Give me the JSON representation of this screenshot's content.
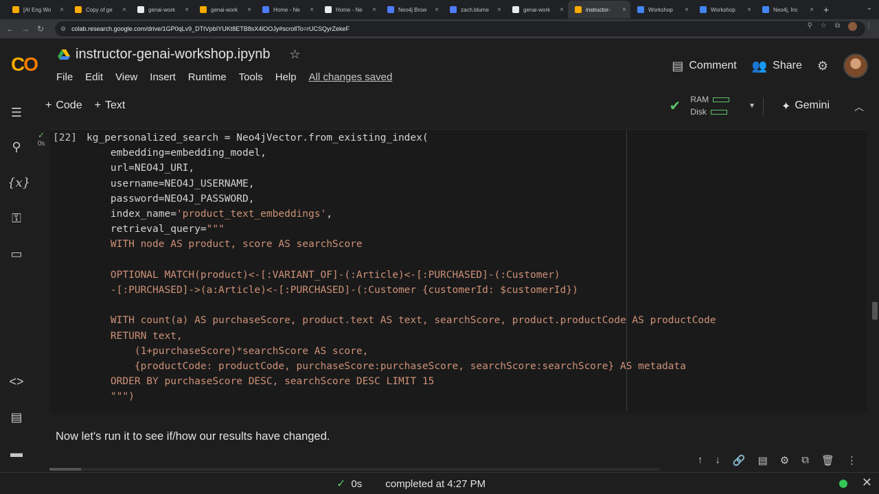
{
  "browser": {
    "tabs": [
      {
        "title": "[AI Eng Wo",
        "favicon_color": "#f9ab00",
        "active": false
      },
      {
        "title": "Copy of ge",
        "favicon_color": "#f9ab00",
        "active": false
      },
      {
        "title": "genai-work",
        "favicon_color": "#e8eaed",
        "active": false
      },
      {
        "title": "genai-work",
        "favicon_color": "#f9ab00",
        "active": false
      },
      {
        "title": "Home - Ne",
        "favicon_color": "#4d7cfe",
        "active": false
      },
      {
        "title": "Home - Ne",
        "favicon_color": "#e8eaed",
        "active": false
      },
      {
        "title": "Neo4j Brow",
        "favicon_color": "#4d7cfe",
        "active": false
      },
      {
        "title": "zach.blume",
        "favicon_color": "#4d7cfe",
        "active": false
      },
      {
        "title": "genai-work",
        "favicon_color": "#e8eaed",
        "active": false
      },
      {
        "title": "instructor-",
        "favicon_color": "#f9ab00",
        "active": true
      },
      {
        "title": "Workshop",
        "favicon_color": "#4285f4",
        "active": false
      },
      {
        "title": "Workshop",
        "favicon_color": "#4285f4",
        "active": false
      },
      {
        "title": "Neo4j, Inc",
        "favicon_color": "#4285f4",
        "active": false
      }
    ],
    "url": "colab.research.google.com/drive/1GP0qLv9_DTtVpbIYUKt8ETB8sX4lOOJy#scrollTo=rUCSQyrZekeF"
  },
  "header": {
    "title": "instructor-genai-workshop.ipynb",
    "menu": [
      "File",
      "Edit",
      "View",
      "Insert",
      "Runtime",
      "Tools",
      "Help"
    ],
    "saved_status": "All changes saved",
    "comment_label": "Comment",
    "share_label": "Share"
  },
  "toolbar": {
    "add_code_label": "Code",
    "add_text_label": "Text",
    "ram_label": "RAM",
    "disk_label": "Disk",
    "gemini_label": "Gemini"
  },
  "cell": {
    "exec_count": "[22]",
    "exec_time": "0s",
    "lines": [
      "kg_personalized_search = Neo4jVector.from_existing_index(",
      "    embedding=embedding_model,",
      "    url=NEO4J_URI,",
      "    username=NEO4J_USERNAME,",
      "    password=NEO4J_PASSWORD,",
      "    index_name='product_text_embeddings',",
      "    retrieval_query=\"\"\"",
      "    WITH node AS product, score AS searchScore",
      "",
      "    OPTIONAL MATCH(product)<-[:VARIANT_OF]-(:Article)<-[:PURCHASED]-(:Customer)",
      "    -[:PURCHASED]->(a:Article)<-[:PURCHASED]-(:Customer {customerId: $customerId})",
      "",
      "    WITH count(a) AS purchaseScore, product.text AS text, searchScore, product.productCode AS productCode",
      "    RETURN text,",
      "        (1+purchaseScore)*searchScore AS score,",
      "        {productCode: productCode, purchaseScore:purchaseScore, searchScore:searchScore} AS metadata",
      "    ORDER BY purchaseScore DESC, searchScore DESC LIMIT 15",
      "    \"\"\")"
    ]
  },
  "text_cell": {
    "text": "Now let's run it to see if/how our results have changed."
  },
  "status": {
    "time": "0s",
    "message": "completed at 4:27 PM"
  },
  "colors": {
    "accent_green": "#5ec46b",
    "colab_orange": "#f9ab00"
  }
}
